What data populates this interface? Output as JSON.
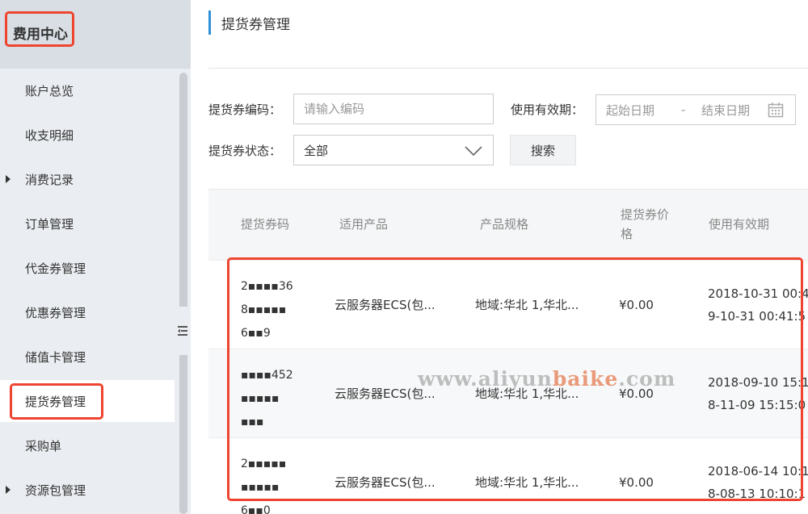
{
  "sidebar": {
    "header": "费用中心",
    "items": [
      {
        "label": "账户总览",
        "caret": false,
        "active": false
      },
      {
        "label": "收支明细",
        "caret": false,
        "active": false
      },
      {
        "label": "消费记录",
        "caret": true,
        "active": false
      },
      {
        "label": "订单管理",
        "caret": false,
        "active": false
      },
      {
        "label": "代金券管理",
        "caret": false,
        "active": false
      },
      {
        "label": "优惠券管理",
        "caret": false,
        "active": false
      },
      {
        "label": "储值卡管理",
        "caret": false,
        "active": false
      },
      {
        "label": "提货券管理",
        "caret": false,
        "active": true
      },
      {
        "label": "采购单",
        "caret": false,
        "active": false
      },
      {
        "label": "资源包管理",
        "caret": true,
        "active": false
      }
    ]
  },
  "main": {
    "title": "提货券管理",
    "filters": {
      "code_label": "提货券编码：",
      "code_placeholder": "请输入编码",
      "validity_label": "使用有效期：",
      "start_placeholder": "起始日期",
      "separator": "-",
      "end_placeholder": "结束日期",
      "status_label": "提货券状态：",
      "status_value": "全部",
      "search_label": "搜索"
    },
    "table": {
      "headers": [
        "提货券码",
        "适用产品",
        "产品规格",
        "提货券价格",
        "使用有效期"
      ],
      "rows": [
        {
          "code": [
            "2▪▪▪▪36",
            "8▪▪▪▪▪",
            "6▪▪9"
          ],
          "product": "云服务器ECS(包...",
          "spec": "地域:华北 1,华北...",
          "price": "¥0.00",
          "validity": [
            "2018-10-31 00:4",
            "9-10-31 00:41:5"
          ]
        },
        {
          "code": [
            "▪▪▪▪452",
            "▪▪▪▪▪",
            "▪▪▪"
          ],
          "product": "云服务器ECS(包...",
          "spec": "地域:华北 1,华北...",
          "price": "¥0.00",
          "validity": [
            "2018-09-10 15:1",
            "8-11-09 15:15:0"
          ]
        },
        {
          "code": [
            "2▪▪▪▪▪",
            "▪▪▪▪▪",
            "6▪▪0"
          ],
          "product": "云服务器ECS(包...",
          "spec": "地域:华北 1,华北...",
          "price": "¥0.00",
          "validity": [
            "2018-06-14 10:1",
            "8-08-13 10:10:1"
          ]
        }
      ]
    }
  },
  "watermark": {
    "prefix": "www.aliyun",
    "accent": "baike",
    "suffix": ".com"
  },
  "colors": {
    "highlight": "#ee4430",
    "title_accent": "#2f8fd8",
    "sidebar_bg": "#eaedf1",
    "sidebar_header_bg": "#d9dee4"
  },
  "icons": {
    "collapse": "collapse-sidebar-icon",
    "calendar": "calendar-icon",
    "select": "chevron-down-icon",
    "submenu": "caret-right-icon"
  }
}
